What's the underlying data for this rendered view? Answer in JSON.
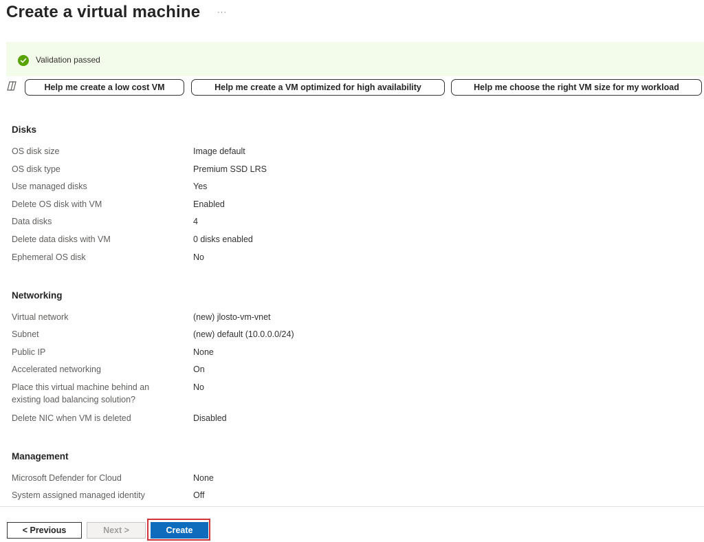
{
  "header": {
    "title": "Create a virtual machine",
    "more": "···"
  },
  "validation": {
    "text": "Validation passed",
    "icon": "check-circle-icon",
    "color": "#57a300"
  },
  "copilot": {
    "icon": "copilot-icon",
    "prompts": [
      "Help me create a low cost VM",
      "Help me create a VM optimized for high availability",
      "Help me choose the right VM size for my workload"
    ]
  },
  "disks": {
    "title": "Disks",
    "rows": [
      {
        "label": "OS disk size",
        "value": "Image default"
      },
      {
        "label": "OS disk type",
        "value": "Premium SSD LRS"
      },
      {
        "label": "Use managed disks",
        "value": "Yes"
      },
      {
        "label": "Delete OS disk with VM",
        "value": "Enabled"
      },
      {
        "label": "Data disks",
        "value": "4"
      },
      {
        "label": "Delete data disks with VM",
        "value": "0 disks enabled"
      },
      {
        "label": "Ephemeral OS disk",
        "value": "No"
      }
    ]
  },
  "networking": {
    "title": "Networking",
    "rows": [
      {
        "label": "Virtual network",
        "value": "(new) jlosto-vm-vnet"
      },
      {
        "label": "Subnet",
        "value": "(new) default (10.0.0.0/24)"
      },
      {
        "label": "Public IP",
        "value": "None"
      },
      {
        "label": "Accelerated networking",
        "value": "On"
      },
      {
        "label": "Place this virtual machine behind an existing load balancing solution?",
        "value": "No"
      },
      {
        "label": "Delete NIC when VM is deleted",
        "value": "Disabled"
      }
    ]
  },
  "management": {
    "title": "Management",
    "rows": [
      {
        "label": "Microsoft Defender for Cloud",
        "value": "None"
      },
      {
        "label": "System assigned managed identity",
        "value": "Off"
      }
    ]
  },
  "footer": {
    "previous": "< Previous",
    "next": "Next >",
    "create": "Create"
  },
  "colors": {
    "accent": "#0f6cbd",
    "highlight": "#d13438",
    "validation_bg": "#f3fbea"
  }
}
